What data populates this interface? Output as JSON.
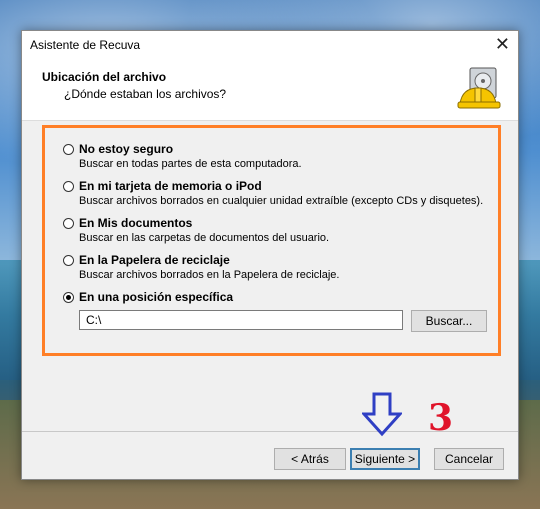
{
  "window": {
    "title": "Asistente de Recuva",
    "close_symbol": "✕"
  },
  "header": {
    "title": "Ubicación del archivo",
    "subtitle": "¿Dónde estaban los archivos?",
    "logo_icon": "recuva-hardhat-drive-icon"
  },
  "options": [
    {
      "label": "No estoy seguro",
      "description": "Buscar en todas partes de esta computadora.",
      "selected": false
    },
    {
      "label": "En mi tarjeta de memoria o iPod",
      "description": "Buscar archivos borrados en cualquier unidad extraíble (excepto CDs y disquetes).",
      "selected": false
    },
    {
      "label": "En Mis documentos",
      "description": "Buscar en las carpetas de documentos del usuario.",
      "selected": false
    },
    {
      "label": "En la Papelera de reciclaje",
      "description": "Buscar archivos borrados en la Papelera de reciclaje.",
      "selected": false
    },
    {
      "label": "En una posición específica",
      "description": "",
      "selected": true
    }
  ],
  "location": {
    "path_value": "C:\\",
    "browse_label": "Buscar..."
  },
  "footer": {
    "back_label": "< Atrás",
    "next_label": "Siguiente >",
    "cancel_label": "Cancelar"
  },
  "annotation": {
    "step_number": "3",
    "highlight_color": "#ff7f27",
    "arrow_color": "#2f3fc4",
    "number_color": "#e0142a"
  }
}
